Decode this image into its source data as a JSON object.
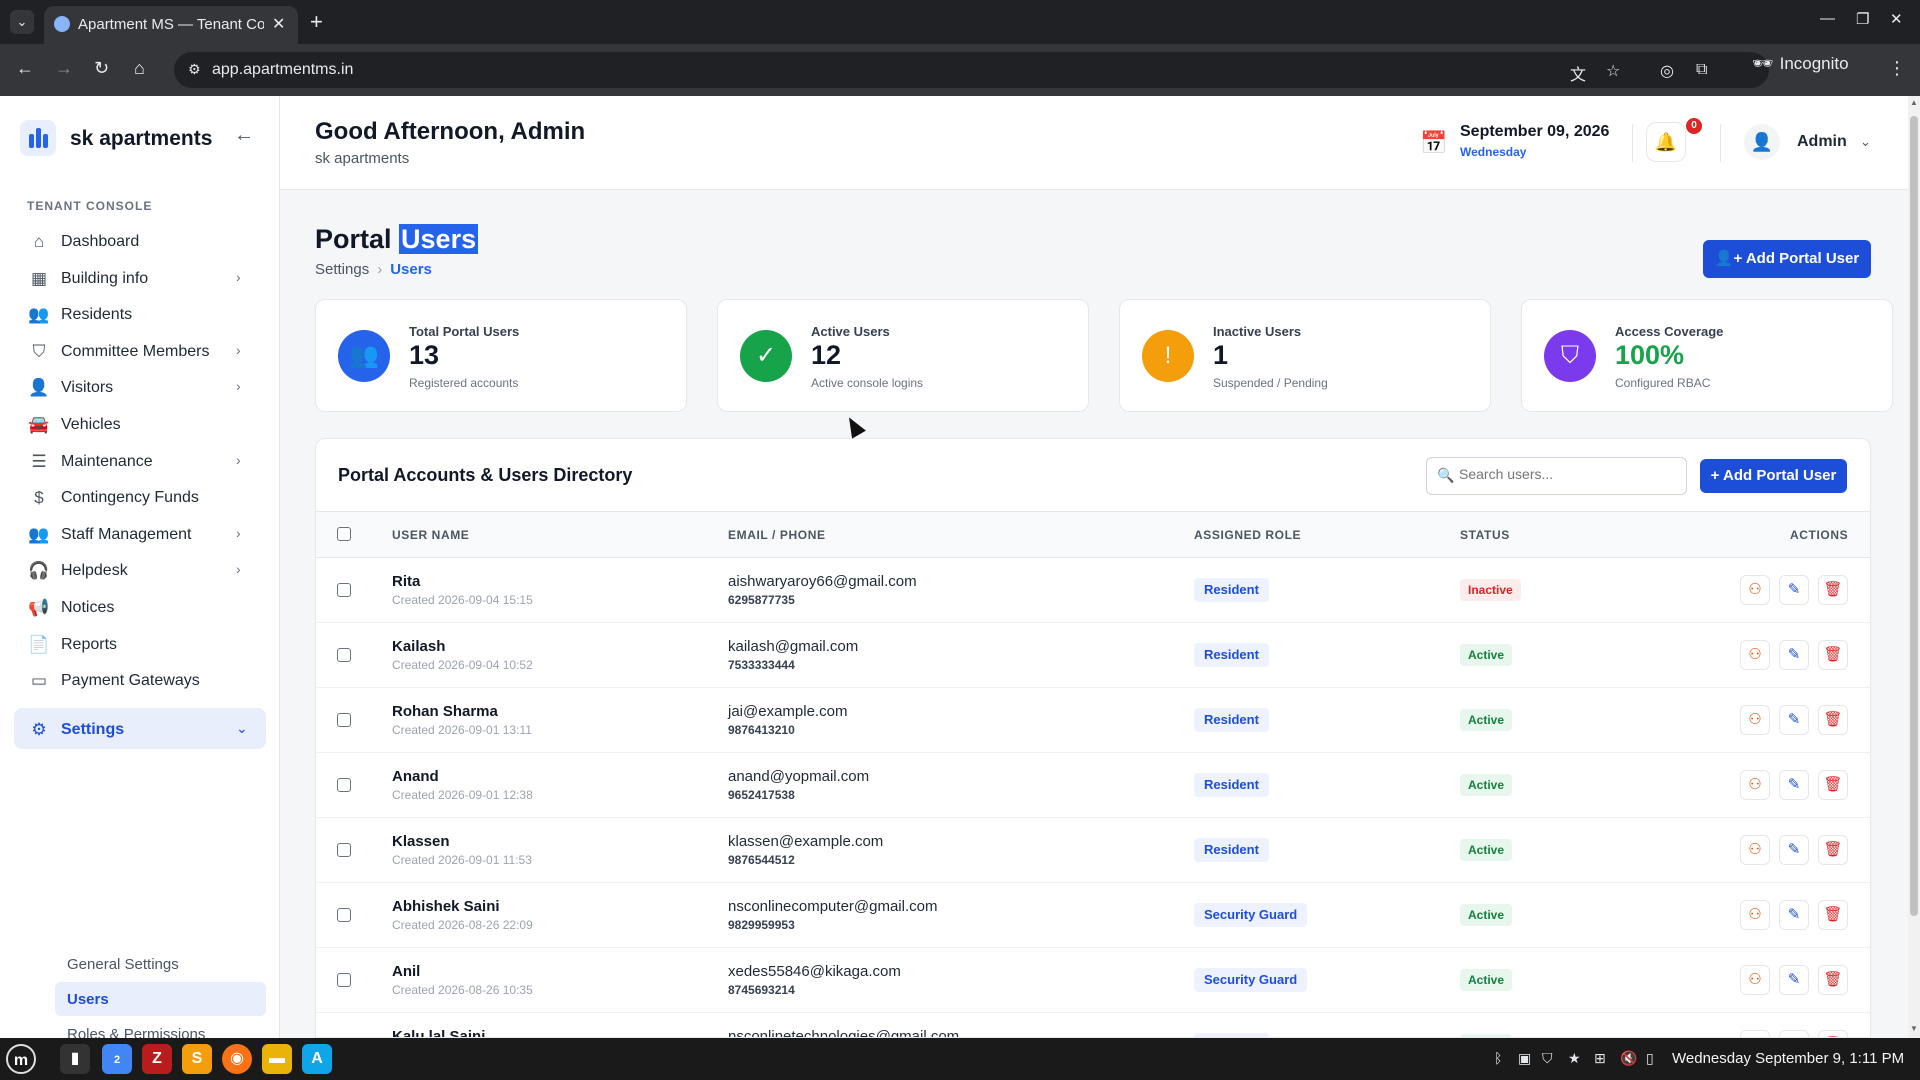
{
  "browser": {
    "tab_title": "Apartment MS — Tenant Console",
    "url": "app.apartmentms.in",
    "profile": "Incognito",
    "tab_menu_icon": "chevron-down-icon",
    "new_tab_icon": "plus-icon"
  },
  "brand": {
    "name": "sk apartments"
  },
  "sidebar": {
    "section_label": "TENANT CONSOLE",
    "items": [
      {
        "label": "Dashboard",
        "icon": "home-icon",
        "glyph": "⌂",
        "chevron": false
      },
      {
        "label": "Building info",
        "icon": "grid-icon",
        "glyph": "▦",
        "chevron": true
      },
      {
        "label": "Residents",
        "icon": "users-icon",
        "glyph": "👥",
        "chevron": false
      },
      {
        "label": "Committee Members",
        "icon": "shield-icon",
        "glyph": "⛉",
        "chevron": true
      },
      {
        "label": "Visitors",
        "icon": "user-plus-icon",
        "glyph": "👤",
        "chevron": true
      },
      {
        "label": "Vehicles",
        "icon": "car-icon",
        "glyph": "🚘",
        "chevron": false
      },
      {
        "label": "Maintenance",
        "icon": "server-icon",
        "glyph": "☰",
        "chevron": true
      },
      {
        "label": "Contingency Funds",
        "icon": "dollar-icon",
        "glyph": "$",
        "chevron": false
      },
      {
        "label": "Staff Management",
        "icon": "users-icon",
        "glyph": "👥",
        "chevron": true
      },
      {
        "label": "Helpdesk",
        "icon": "headset-icon",
        "glyph": "🎧",
        "chevron": true
      },
      {
        "label": "Notices",
        "icon": "megaphone-icon",
        "glyph": "📢",
        "chevron": false
      },
      {
        "label": "Reports",
        "icon": "file-icon",
        "glyph": "📄",
        "chevron": false
      },
      {
        "label": "Payment Gateways",
        "icon": "credit-card-icon",
        "glyph": "▭",
        "chevron": false
      },
      {
        "label": "Settings",
        "icon": "gear-icon",
        "glyph": "⚙",
        "chevron": true,
        "active": true,
        "expanded": true
      }
    ],
    "settings_sub": [
      {
        "label": "General Settings"
      },
      {
        "label": "Users",
        "active": true
      },
      {
        "label": "Roles & Permissions"
      }
    ]
  },
  "header": {
    "greeting": "Good Afternoon, Admin",
    "subtitle": "sk apartments",
    "date": "September 09, 2026",
    "weekday": "Wednesday",
    "notification_count": "0",
    "user": "Admin"
  },
  "page": {
    "title_prefix": "Portal",
    "title_highlight": "Users",
    "breadcrumb": [
      "Settings",
      "Users"
    ],
    "add_button": "Add Portal User"
  },
  "stats": [
    {
      "label": "Total Portal Users",
      "value": "13",
      "sub": "Registered accounts",
      "color": "#2563eb",
      "icon": "users-icon",
      "glyph": "👥",
      "value_color": "#111827"
    },
    {
      "label": "Active Users",
      "value": "12",
      "sub": "Active console logins",
      "color": "#16a34a",
      "icon": "check-circle-icon",
      "glyph": "✓",
      "value_color": "#111827"
    },
    {
      "label": "Inactive Users",
      "value": "1",
      "sub": "Suspended / Pending",
      "color": "#f59e0b",
      "icon": "alert-circle-icon",
      "glyph": "!",
      "value_color": "#111827"
    },
    {
      "label": "Access Coverage",
      "value": "100%",
      "sub": "Configured RBAC",
      "color": "#7c3aed",
      "icon": "shield-icon",
      "glyph": "⛉",
      "value_color": "#16a34a"
    }
  ],
  "directory": {
    "title": "Portal Accounts & Users Directory",
    "search_placeholder": "Search users...",
    "add_button": "+ Add Portal User",
    "columns": [
      "USER NAME",
      "EMAIL / PHONE",
      "ASSIGNED ROLE",
      "STATUS",
      "ACTIONS"
    ],
    "rows": [
      {
        "name": "Rita",
        "created": "Created 2026-09-04 15:15",
        "email": "aishwaryaroy66@gmail.com",
        "phone": "6295877735",
        "role": "Resident",
        "status": "Inactive"
      },
      {
        "name": "Kailash",
        "created": "Created 2026-09-04 10:52",
        "email": "kailash@gmail.com",
        "phone": "7533333444",
        "role": "Resident",
        "status": "Active"
      },
      {
        "name": "Rohan Sharma",
        "created": "Created 2026-09-01 13:11",
        "email": "jai@example.com",
        "phone": "9876413210",
        "role": "Resident",
        "status": "Active"
      },
      {
        "name": "Anand",
        "created": "Created 2026-09-01 12:38",
        "email": "anand@yopmail.com",
        "phone": "9652417538",
        "role": "Resident",
        "status": "Active"
      },
      {
        "name": "Klassen",
        "created": "Created 2026-09-01 11:53",
        "email": "klassen@example.com",
        "phone": "9876544512",
        "role": "Resident",
        "status": "Active"
      },
      {
        "name": "Abhishek Saini",
        "created": "Created 2026-08-26 22:09",
        "email": "nsconlinecomputer@gmail.com",
        "phone": "9829959953",
        "role": "Security Guard",
        "status": "Active"
      },
      {
        "name": "Anil",
        "created": "Created 2026-08-26 10:35",
        "email": "xedes55846@kikaga.com",
        "phone": "8745693214",
        "role": "Security Guard",
        "status": "Active"
      },
      {
        "name": "Kalu lal Saini",
        "created": "",
        "email": "nsconlinetechnologies@gmail.com",
        "phone": "",
        "role": "Resident",
        "status": "Active"
      }
    ]
  },
  "taskbar": {
    "clock": "Wednesday September 9, 1:11 PM",
    "chrome_badge": "2"
  }
}
